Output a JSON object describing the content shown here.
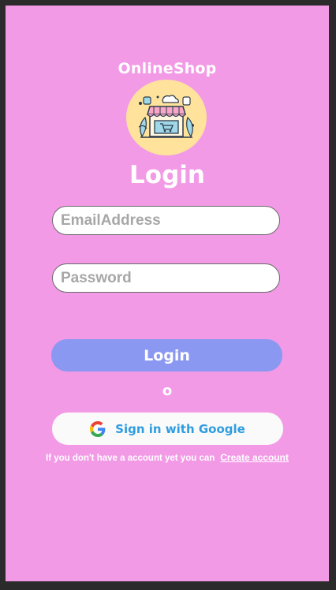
{
  "app": {
    "brand": "OnlineShop",
    "logo_icon": "shop-storefront-icon"
  },
  "form": {
    "title": "Login",
    "email_placeholder": "EmailAddress",
    "password_placeholder": "Password",
    "login_label": "Login",
    "separator": "o",
    "google_label": "Sign in with Google",
    "google_icon": "google-g-icon"
  },
  "footer": {
    "text": "If you don't have a account yet you can",
    "link_label": "Create account"
  },
  "colors": {
    "background": "#f29ae6",
    "login_button": "#8b98f2",
    "logo_circle": "#ffe39c",
    "google_text": "#2f9de0"
  }
}
